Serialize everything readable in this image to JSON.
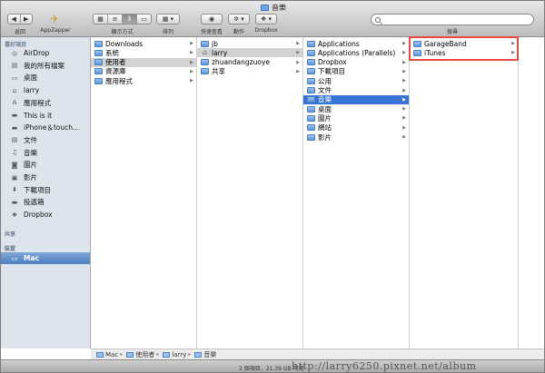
{
  "window": {
    "title": "音樂"
  },
  "toolbar": {
    "back_label": "返回",
    "appzapper_label": "AppZapper",
    "view_label": "顯示方式",
    "arrange_label": "排列",
    "quicklook_label": "快速查看",
    "action_label": "動作",
    "dropbox_label": "Dropbox",
    "search_label": "搜尋"
  },
  "sidebar": {
    "favorites_header": "喜好項目",
    "favorites": [
      {
        "label": "AirDrop",
        "icon": "airdrop-icon"
      },
      {
        "label": "我的所有檔案",
        "icon": "all-files-icon"
      },
      {
        "label": "桌面",
        "icon": "desktop-icon"
      },
      {
        "label": "larry",
        "icon": "home-icon"
      },
      {
        "label": "應用程式",
        "icon": "applications-icon"
      },
      {
        "label": "This is it",
        "icon": "folder-icon"
      },
      {
        "label": "iPhone＆touch...",
        "icon": "folder-icon"
      },
      {
        "label": "文件",
        "icon": "documents-icon"
      },
      {
        "label": "音樂",
        "icon": "music-icon"
      },
      {
        "label": "圖片",
        "icon": "pictures-icon"
      },
      {
        "label": "影片",
        "icon": "movies-icon"
      },
      {
        "label": "下載項目",
        "icon": "downloads-icon"
      },
      {
        "label": "投遞箱",
        "icon": "dropbox-folder-icon"
      },
      {
        "label": "Dropbox",
        "icon": "dropbox-icon"
      }
    ],
    "shared_header": "共享",
    "devices_header": "裝置",
    "devices": [
      {
        "label": "Mac",
        "icon": "mac-icon"
      }
    ]
  },
  "columns": [
    [
      {
        "label": "Downloads"
      },
      {
        "label": "系統"
      },
      {
        "label": "使用者",
        "selected": true
      },
      {
        "label": "資源庫"
      },
      {
        "label": "應用程式"
      }
    ],
    [
      {
        "label": "jb"
      },
      {
        "label": "larry",
        "selected": true,
        "home": true
      },
      {
        "label": "zhuandangzuoye"
      },
      {
        "label": "共享"
      }
    ],
    [
      {
        "label": "Applications"
      },
      {
        "label": "Applications (Parallels)"
      },
      {
        "label": "Dropbox"
      },
      {
        "label": "下載項目"
      },
      {
        "label": "公用"
      },
      {
        "label": "文件"
      },
      {
        "label": "音樂",
        "selected": true
      },
      {
        "label": "桌面"
      },
      {
        "label": "圖片"
      },
      {
        "label": "網站"
      },
      {
        "label": "影片"
      }
    ],
    [
      {
        "label": "GarageBand"
      },
      {
        "label": "iTunes"
      }
    ]
  ],
  "pathbar": [
    "Mac",
    "使用者",
    "larry",
    "音樂"
  ],
  "status": {
    "text": "2 個項目，21.39 GB 可用",
    "watermark": "http://larry6250.pixnet.net/album"
  },
  "colors": {
    "selection": "#3874d6",
    "highlight_box": "#e54a43",
    "sidebar_bg": "#dde4ec"
  }
}
